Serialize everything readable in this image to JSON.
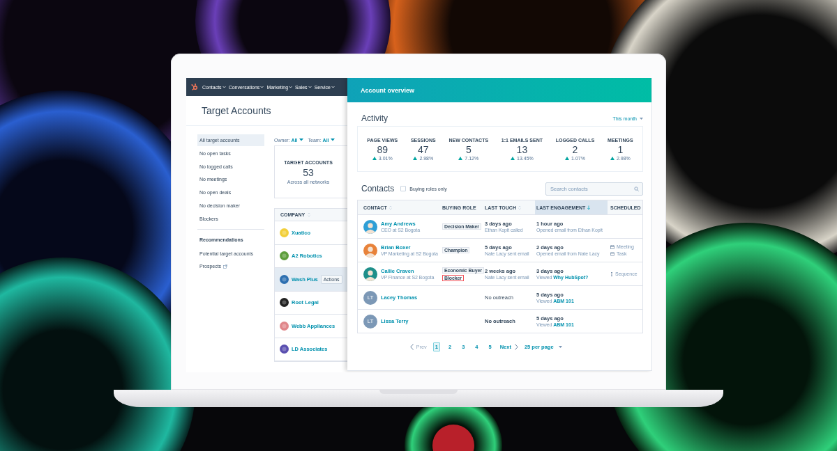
{
  "nav": {
    "items": [
      {
        "label": "Contacts"
      },
      {
        "label": "Conversations"
      },
      {
        "label": "Marketing"
      },
      {
        "label": "Sales"
      },
      {
        "label": "Service"
      }
    ]
  },
  "page_title": "Target Accounts",
  "sidebar": {
    "items": [
      {
        "label": "All target accounts",
        "selected": true
      },
      {
        "label": "No open tasks",
        "selected": false
      },
      {
        "label": "No logged calls",
        "selected": false
      },
      {
        "label": "No meetings",
        "selected": false
      },
      {
        "label": "No open deals",
        "selected": false
      },
      {
        "label": "No decision maker",
        "selected": false
      },
      {
        "label": "Blockers",
        "selected": false
      }
    ],
    "section_title": "Recommendations",
    "recommendations": [
      {
        "label": "Potential target accounts",
        "external": false
      },
      {
        "label": "Prospects",
        "external": true
      }
    ]
  },
  "filters": [
    {
      "label": "Owner:",
      "value": "All"
    },
    {
      "label": "Team:",
      "value": "All"
    }
  ],
  "summary_card": {
    "title": "TARGET ACCOUNTS",
    "value": "53",
    "caption": "Across all networks"
  },
  "companies": {
    "column": "COMPANY",
    "rows": [
      {
        "name": "Xuatico",
        "color": "#f2cf3a",
        "hovered": false
      },
      {
        "name": "A2 Robotics",
        "color": "#5e9e3c",
        "hovered": false
      },
      {
        "name": "Wash Plus",
        "color": "#2d6fb0",
        "hovered": true,
        "action": "Actions"
      },
      {
        "name": "Root Legal",
        "color": "#222222",
        "hovered": false
      },
      {
        "name": "Webb Appliances",
        "color": "#e0868a",
        "hovered": false
      },
      {
        "name": "LD Associates",
        "color": "#5a4fb0",
        "hovered": false
      }
    ]
  },
  "panel": {
    "title": "Account overview",
    "activity_title": "Activity",
    "period": "This month",
    "stats": [
      {
        "label": "PAGE VIEWS",
        "value": "89",
        "change": "3.01%"
      },
      {
        "label": "SESSIONS",
        "value": "47",
        "change": "2.98%"
      },
      {
        "label": "NEW CONTACTS",
        "value": "5",
        "change": "7.12%"
      },
      {
        "label": "1:1 EMAILS SENT",
        "value": "13",
        "change": "13.45%"
      },
      {
        "label": "LOGGED CALLS",
        "value": "2",
        "change": "1.07%"
      },
      {
        "label": "MEETINGS",
        "value": "1",
        "change": "2.98%"
      }
    ],
    "contacts_title": "Contacts",
    "buying_filter": {
      "label": "Buying roles only",
      "checked": false
    },
    "search": {
      "placeholder": "Search contacts"
    },
    "columns": [
      {
        "label": "CONTACT",
        "kind": "sortable",
        "selected": false
      },
      {
        "label": "BUYING ROLE",
        "kind": "plain",
        "selected": false
      },
      {
        "label": "LAST TOUCH",
        "kind": "sortable",
        "selected": false
      },
      {
        "label": "LAST ENGAGEMENT",
        "kind": "sorted",
        "selected": true
      },
      {
        "label": "SCHEDULED",
        "kind": "plain",
        "selected": false
      }
    ],
    "rows": [
      {
        "name": "Amy Andrews",
        "title": "CEO at S2 Bogota",
        "color": "#2f9fd6",
        "roles": [
          {
            "label": "Decision Maker",
            "kind": "normal"
          }
        ],
        "last_touch": {
          "main": "3 days ago",
          "sub": "Ethan Kopit called"
        },
        "last_engagement": {
          "main": "1 hour ago",
          "sub": "Opened email from Ethan Kopit"
        },
        "scheduled": []
      },
      {
        "name": "Brian Boxer",
        "title": "VP Marketing at S2 Bogota",
        "color": "#e8823a",
        "roles": [
          {
            "label": "Champion",
            "kind": "normal"
          }
        ],
        "last_touch": {
          "main": "5 days ago",
          "sub": "Nate Lacy sent email"
        },
        "last_engagement": {
          "main": "2 days ago",
          "sub": "Opened email from Nate Lacy"
        },
        "scheduled": [
          {
            "kind": "meeting",
            "label": "Meeting"
          },
          {
            "kind": "task",
            "label": "Task"
          }
        ]
      },
      {
        "name": "Callie Craven",
        "title": "VP Finance at S2 Bogota",
        "color": "#1f8f8a",
        "roles": [
          {
            "label": "Economic Buyer",
            "kind": "normal"
          },
          {
            "label": "Blocker",
            "kind": "blocker"
          }
        ],
        "last_touch": {
          "main": "2 weeks ago",
          "sub": "Nate Lacy sent email"
        },
        "last_engagement": {
          "main": "3 days ago",
          "sub": "Viewed",
          "link": "Why HubSpot?"
        },
        "scheduled": [
          {
            "kind": "sequence",
            "label": "Sequence"
          }
        ]
      },
      {
        "name": "Lacey Thomas",
        "kind": "initials",
        "initials": "LT",
        "color": "#7c98b6",
        "roles": [],
        "last_touch": {
          "main": "No outreach",
          "bold": false
        },
        "last_engagement": {
          "main": "5 days ago",
          "sub": "Viewed",
          "link": "ABM 101"
        },
        "scheduled": []
      },
      {
        "name": "Lissa Terry",
        "kind": "initials",
        "initials": "LT",
        "color": "#7c98b6",
        "roles": [],
        "last_touch": {
          "main": "No outreach",
          "bold": true
        },
        "last_engagement": {
          "main": "5 days ago",
          "sub": "Viewed",
          "link": "ABM 101"
        },
        "scheduled": []
      }
    ],
    "pagination": {
      "prev": "Prev",
      "pages": [
        {
          "label": "1",
          "selected": true
        },
        {
          "label": "2",
          "selected": false
        },
        {
          "label": "3",
          "selected": false
        },
        {
          "label": "4",
          "selected": false
        },
        {
          "label": "5",
          "selected": false
        }
      ],
      "next": "Next",
      "per_page": "25 per page"
    }
  }
}
